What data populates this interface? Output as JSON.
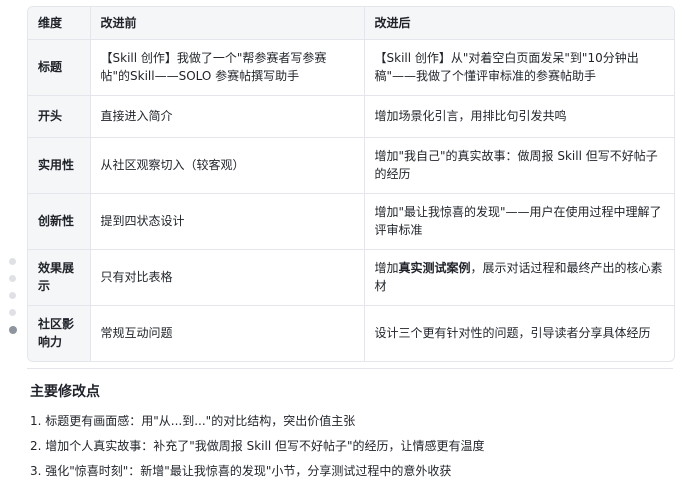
{
  "table": {
    "headers": [
      "维度",
      "改进前",
      "改进后"
    ],
    "rows": [
      {
        "dimension": "标题",
        "before": "【Skill 创作】我做了一个\"帮参赛者写参赛帖\"的Skill——SOLO 参赛帖撰写助手",
        "after": "【Skill 创作】从\"对着空白页面发呆\"到\"10分钟出稿\"——我做了个懂评审标准的参赛帖助手"
      },
      {
        "dimension": "开头",
        "before": "直接进入简介",
        "after": "增加场景化引言，用排比句引发共鸣"
      },
      {
        "dimension": "实用性",
        "before": "从社区观察切入（较客观）",
        "after": "增加\"我自己\"的真实故事：做周报 Skill 但写不好帖子的经历"
      },
      {
        "dimension": "创新性",
        "before": "提到四状态设计",
        "after": "增加\"最让我惊喜的发现\"——用户在使用过程中理解了评审标准"
      },
      {
        "dimension": "效果展示",
        "before": "只有对比表格",
        "after_prefix": "增加",
        "after_bold": "真实测试案例",
        "after_suffix": "，展示对话过程和最终产出的核心素材"
      },
      {
        "dimension": "社区影响力",
        "before": "常规互动问题",
        "after": "设计三个更有针对性的问题，引导读者分享具体经历"
      }
    ]
  },
  "summary": {
    "title": "主要修改点",
    "items": [
      "1. 标题更有画面感：用\"从...到...\"的对比结构，突出价值主张",
      "2. 增加个人真实故事：补充了\"我做周报 Skill 但写不好帖子\"的经历，让情感更有温度",
      "3. 强化\"惊喜时刻\"：新增\"最让我惊喜的发现\"小节，分享测试过程中的意外收获"
    ]
  }
}
